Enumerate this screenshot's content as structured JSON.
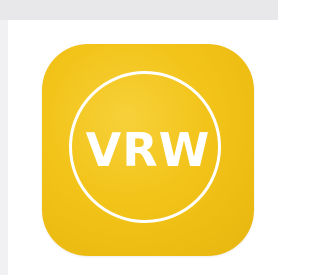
{
  "app": {
    "icon_name": "vrw-app-icon",
    "logo_text": "VRW",
    "brand_color": "#f2c318",
    "logo_color": "#ffffff"
  }
}
